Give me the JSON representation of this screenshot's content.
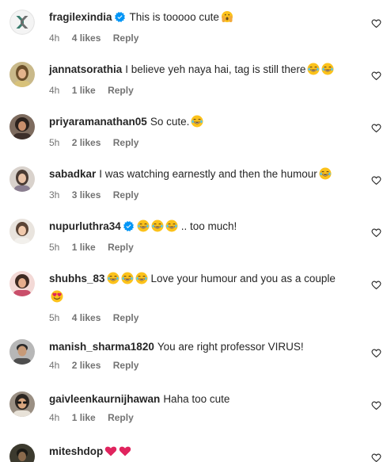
{
  "comments": [
    {
      "username": "fragilexindia",
      "verified": true,
      "text": "This is tooooo cute",
      "emoji": [
        "hands"
      ],
      "time": "4h",
      "likes": "4 likes",
      "reply": "Reply",
      "avatar": "brand-x",
      "heart_icon": "heart-outline-icon"
    },
    {
      "username": "jannatsorathia",
      "verified": false,
      "text": "I believe yeh naya hai, tag is still there",
      "emoji": [
        "laugh",
        "laugh"
      ],
      "time": "4h",
      "likes": "1 like",
      "reply": "Reply",
      "avatar": "woman-olive",
      "heart_icon": "heart-outline-icon"
    },
    {
      "username": "priyaramanathan05",
      "verified": false,
      "text": "So cute.",
      "emoji": [
        "laugh"
      ],
      "time": "5h",
      "likes": "2 likes",
      "reply": "Reply",
      "avatar": "woman-dark",
      "heart_icon": "heart-outline-icon"
    },
    {
      "username": "sabadkar",
      "verified": false,
      "text": "I was watching earnestly and then the humour",
      "emoji": [
        "laugh"
      ],
      "time": "3h",
      "likes": "3 likes",
      "reply": "Reply",
      "avatar": "woman-light",
      "heart_icon": "heart-outline-icon"
    },
    {
      "username": "nupurluthra34",
      "verified": true,
      "text": ".. too much!",
      "emoji_before": [
        "laugh",
        "laugh",
        "laugh"
      ],
      "time": "5h",
      "likes": "1 like",
      "reply": "Reply",
      "avatar": "woman-light2",
      "heart_icon": "heart-outline-icon"
    },
    {
      "username": "shubhs_83",
      "verified": false,
      "text": "Love your humour and you as a couple",
      "emoji_before": [
        "laugh",
        "laugh",
        "laugh"
      ],
      "emoji_line2": [
        "heart-eyes"
      ],
      "time": "5h",
      "likes": "4 likes",
      "reply": "Reply",
      "avatar": "woman-pink",
      "heart_icon": "heart-outline-icon"
    },
    {
      "username": "manish_sharma1820",
      "verified": false,
      "text": "You are right professor VIRUS!",
      "time": "4h",
      "likes": "2 likes",
      "reply": "Reply",
      "avatar": "man-grey",
      "heart_icon": "heart-outline-icon"
    },
    {
      "username": "gaivleenkaurnijhawan",
      "verified": false,
      "text": "Haha too cute",
      "time": "4h",
      "likes": "1 like",
      "reply": "Reply",
      "avatar": "woman-sunglasses",
      "heart_icon": "heart-outline-icon"
    },
    {
      "username": "miteshdop",
      "verified": false,
      "text": "",
      "emoji": [
        "red-heart",
        "red-heart"
      ],
      "time": "",
      "likes": "",
      "reply": "",
      "avatar": "man-dark",
      "heart_icon": "heart-outline-icon"
    }
  ],
  "colors": {
    "text": "#262626",
    "meta": "#737373",
    "verified": "#0095f6",
    "emoji_face": "#fcc21b",
    "heart_red": "#e0245e"
  }
}
